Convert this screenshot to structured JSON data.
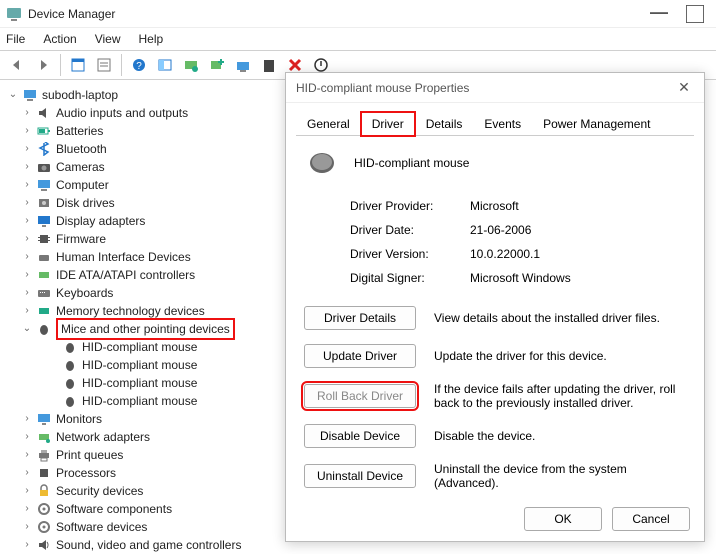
{
  "app": {
    "title": "Device Manager"
  },
  "menu": {
    "file": "File",
    "action": "Action",
    "view": "View",
    "help": "Help"
  },
  "tree": {
    "root": "subodh-laptop",
    "items": [
      {
        "label": "Audio inputs and outputs"
      },
      {
        "label": "Batteries"
      },
      {
        "label": "Bluetooth"
      },
      {
        "label": "Cameras"
      },
      {
        "label": "Computer"
      },
      {
        "label": "Disk drives"
      },
      {
        "label": "Display adapters"
      },
      {
        "label": "Firmware"
      },
      {
        "label": "Human Interface Devices"
      },
      {
        "label": "IDE ATA/ATAPI controllers"
      },
      {
        "label": "Keyboards"
      },
      {
        "label": "Memory technology devices"
      },
      {
        "label": "Mice and other pointing devices"
      },
      {
        "label": "Monitors"
      },
      {
        "label": "Network adapters"
      },
      {
        "label": "Print queues"
      },
      {
        "label": "Processors"
      },
      {
        "label": "Security devices"
      },
      {
        "label": "Software components"
      },
      {
        "label": "Software devices"
      },
      {
        "label": "Sound, video and game controllers"
      }
    ],
    "mice_children": [
      "HID-compliant mouse",
      "HID-compliant mouse",
      "HID-compliant mouse",
      "HID-compliant mouse"
    ]
  },
  "dialog": {
    "title": "HID-compliant mouse Properties",
    "tabs": {
      "general": "General",
      "driver": "Driver",
      "details": "Details",
      "events": "Events",
      "power": "Power Management"
    },
    "device_name": "HID-compliant mouse",
    "info": {
      "provider_lbl": "Driver Provider:",
      "provider_val": "Microsoft",
      "date_lbl": "Driver Date:",
      "date_val": "21-06-2006",
      "version_lbl": "Driver Version:",
      "version_val": "10.0.22000.1",
      "signer_lbl": "Digital Signer:",
      "signer_val": "Microsoft Windows"
    },
    "btns": {
      "details": "Driver Details",
      "details_desc": "View details about the installed driver files.",
      "update": "Update Driver",
      "update_desc": "Update the driver for this device.",
      "rollback": "Roll Back Driver",
      "rollback_desc": "If the device fails after updating the driver, roll back to the previously installed driver.",
      "disable": "Disable Device",
      "disable_desc": "Disable the device.",
      "uninstall": "Uninstall Device",
      "uninstall_desc": "Uninstall the device from the system (Advanced)."
    },
    "ok": "OK",
    "cancel": "Cancel"
  }
}
